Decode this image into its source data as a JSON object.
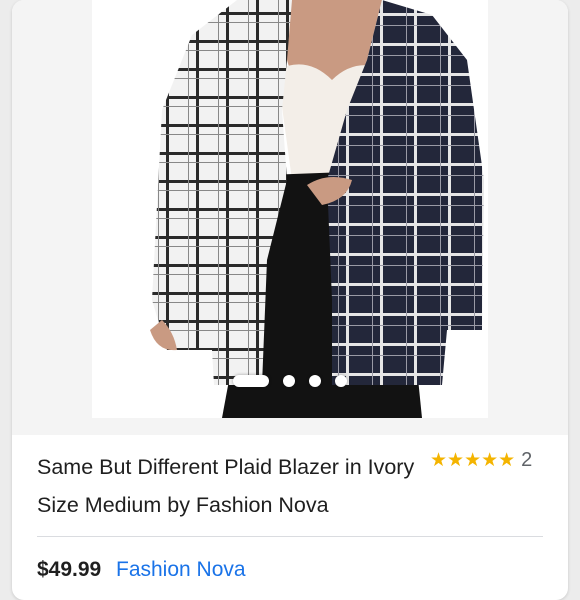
{
  "product": {
    "title": "Same But Different Plaid Blazer in Ivory Size Medium by Fashion Nova",
    "price": "$49.99",
    "seller": "Fashion Nova",
    "rating": {
      "stars": "★★★★★",
      "value": 5,
      "count": "2"
    },
    "image_carousel": {
      "total": 4,
      "active_index": 0
    }
  },
  "colors": {
    "star": "#f4b400",
    "link": "#1a73e8",
    "text": "#1f1f1f"
  }
}
